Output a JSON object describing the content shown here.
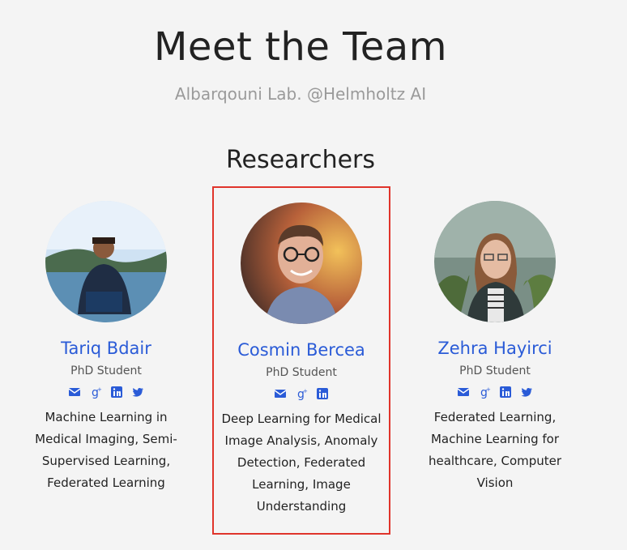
{
  "header": {
    "title": "Meet the Team",
    "subtitle": "Albarqouni Lab. @Helmholtz AI"
  },
  "section": {
    "title": "Researchers"
  },
  "colors": {
    "link": "#2a5bd7",
    "highlight_border": "#e0342b",
    "subtitle": "#9a9a9a"
  },
  "team": [
    {
      "name": "Tariq Bdair",
      "role": "PhD Student",
      "interests": "Machine Learning in Medical Imaging, Semi-Supervised Learning, Federated Learning",
      "socials": [
        "email-icon",
        "google-scholar-icon",
        "linkedin-icon",
        "twitter-icon"
      ]
    },
    {
      "name": "Cosmin Bercea",
      "role": "PhD Student",
      "interests": "Deep Learning for Medical Image Analysis, Anomaly Detection, Federated Learning, Image Understanding",
      "socials": [
        "email-icon",
        "google-scholar-icon",
        "linkedin-icon"
      ]
    },
    {
      "name": "Zehra Hayirci",
      "role": "PhD Student",
      "interests": "Federated Learning, Machine Learning for healthcare, Computer Vision",
      "socials": [
        "email-icon",
        "google-scholar-icon",
        "linkedin-icon",
        "twitter-icon"
      ]
    }
  ]
}
